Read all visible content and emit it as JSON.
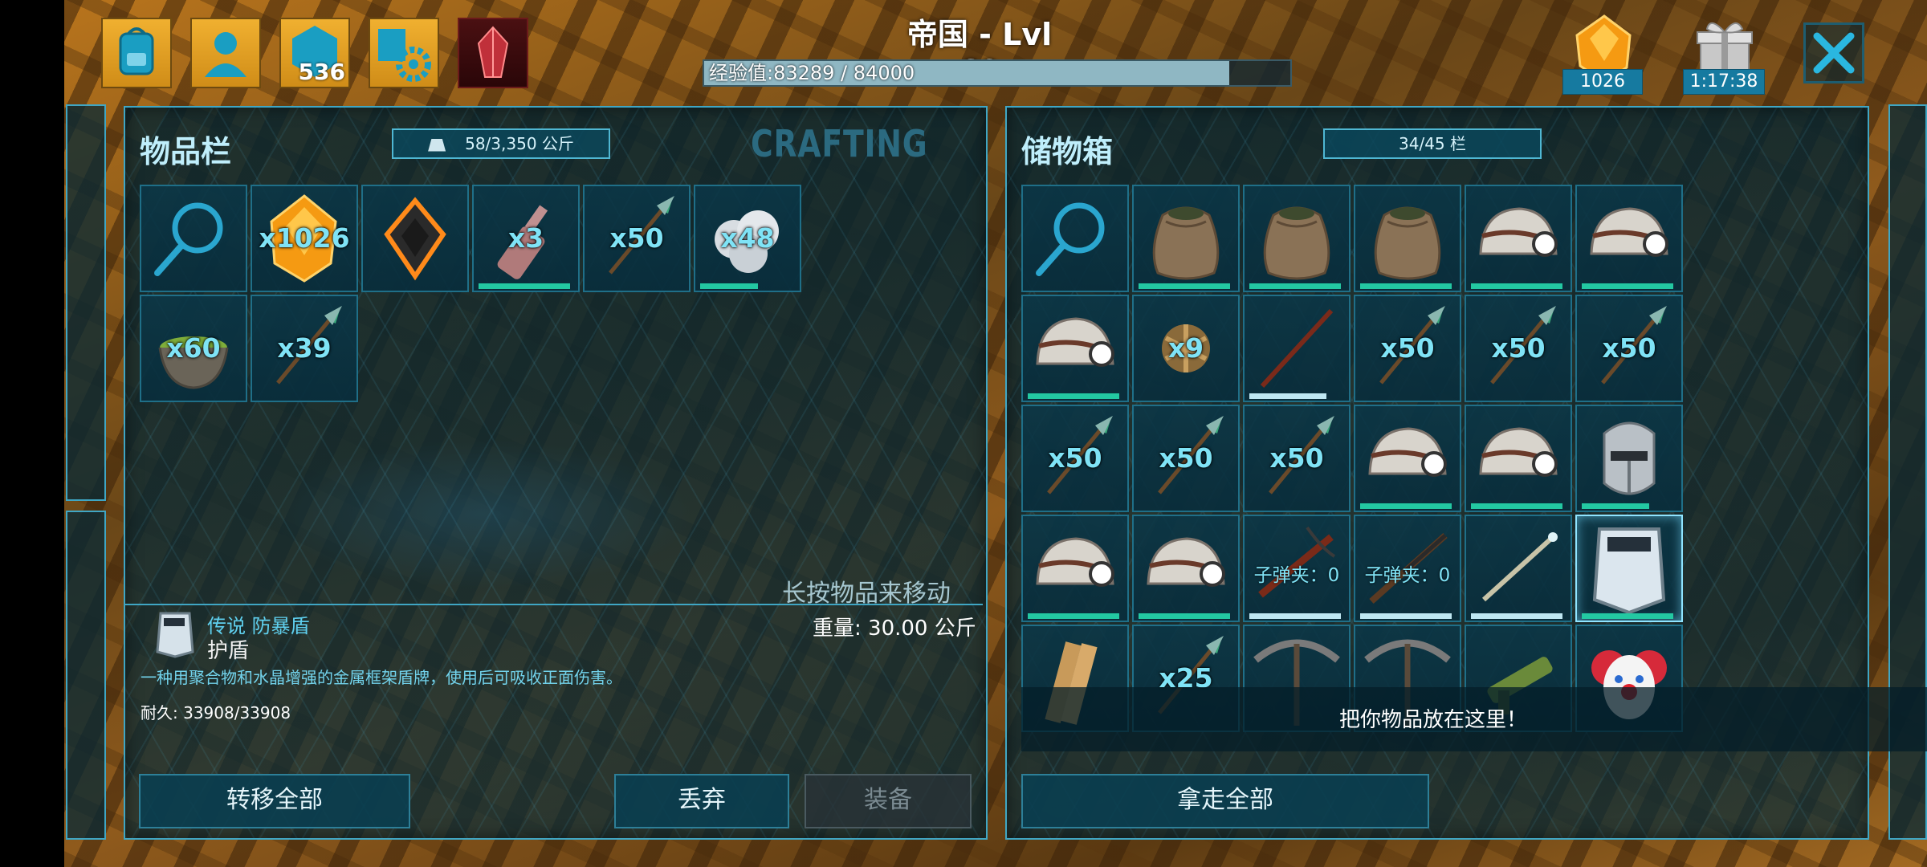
{
  "hud": {
    "title": "帝国 - Lvl 69",
    "xp_text": "经验值:83289 / 84000",
    "xp_fraction": 0.9915,
    "engram_points": "536",
    "resource_count": "1026",
    "timer": "1:17:38",
    "top_icons": [
      "backpack-icon",
      "character-icon",
      "engram-icon",
      "settings-icon",
      "tek-crystal-icon"
    ]
  },
  "inventory": {
    "title": "物品栏",
    "weight_caption": "58/3,350 公斤",
    "crafting_label": "CRAFTING",
    "slots": [
      {
        "icon": "search-icon",
        "qty": ""
      },
      {
        "icon": "element-crystal-icon",
        "qty": "x1026"
      },
      {
        "icon": "implant-icon",
        "qty": ""
      },
      {
        "icon": "bottle-icon",
        "qty": "x3",
        "durability": 0.95
      },
      {
        "icon": "spear-arrow-icon",
        "qty": "x50"
      },
      {
        "icon": "cotton-icon",
        "qty": "x48",
        "durability": 0.6
      },
      {
        "icon": "bowl-soup-icon",
        "qty": "x60"
      },
      {
        "icon": "spear-arrow-icon",
        "qty": "x39"
      }
    ],
    "hint": "长按物品来移动",
    "item_info": {
      "name": "传说 防暴盾",
      "type": "护盾",
      "description": "一种用聚合物和水晶增强的金属框架盾牌，使用后可吸收正面伤害。",
      "durability": "耐久: 33908/33908",
      "weight": "重量: 30.00 公斤"
    },
    "buttons": {
      "transfer_all": "转移全部",
      "drop": "丢弃",
      "equip": "装备"
    }
  },
  "storage": {
    "title": "储物箱",
    "slots_caption": "34/45 栏",
    "drop_hint": "把你物品放在这里！",
    "take_all": "拿走全部",
    "slots": [
      {
        "icon": "search-icon",
        "qty": ""
      },
      {
        "icon": "sack-icon",
        "qty": "",
        "durability": 0.95
      },
      {
        "icon": "sack-icon",
        "qty": "",
        "durability": 0.95
      },
      {
        "icon": "sack-icon",
        "qty": "",
        "durability": 0.95
      },
      {
        "icon": "miner-helmet-icon",
        "qty": "",
        "durability": 0.95
      },
      {
        "icon": "miner-helmet-icon",
        "qty": "",
        "durability": 0.95
      },
      {
        "icon": "miner-helmet-icon",
        "qty": "",
        "durability": 0.95
      },
      {
        "icon": "thatch-ball-icon",
        "qty": "x9"
      },
      {
        "icon": "pike-icon",
        "qty": "",
        "durability": 0.8,
        "light": true
      },
      {
        "icon": "spear-arrow-icon",
        "qty": "x50"
      },
      {
        "icon": "spear-arrow-icon",
        "qty": "x50"
      },
      {
        "icon": "spear-arrow-icon",
        "qty": "x50"
      },
      {
        "icon": "spear-arrow-icon",
        "qty": "x50"
      },
      {
        "icon": "spear-arrow-icon",
        "qty": "x50"
      },
      {
        "icon": "spear-arrow-icon",
        "qty": "x50"
      },
      {
        "icon": "miner-helmet-icon",
        "qty": "",
        "durability": 0.95
      },
      {
        "icon": "miner-helmet-icon",
        "qty": "",
        "durability": 0.95
      },
      {
        "icon": "metal-helmet-icon",
        "qty": "",
        "durability": 0.7
      },
      {
        "icon": "miner-helmet-icon",
        "qty": "",
        "durability": 0.95
      },
      {
        "icon": "miner-helmet-icon",
        "qty": "",
        "durability": 0.95
      },
      {
        "icon": "crossbow-icon",
        "ammo": "子弹夹：0",
        "durability": 0.95,
        "light": true
      },
      {
        "icon": "rifle-icon",
        "ammo": "子弹夹：0",
        "durability": 0.95,
        "light": true
      },
      {
        "icon": "staff-icon",
        "qty": "",
        "durability": 0.95,
        "light": true
      },
      {
        "icon": "riot-shield-icon",
        "qty": "",
        "durability": 0.95,
        "selected": true
      },
      {
        "icon": "wood-plank-icon",
        "qty": ""
      },
      {
        "icon": "spear-arrow-icon",
        "qty": "x25"
      },
      {
        "icon": "pickaxe-icon",
        "qty": ""
      },
      {
        "icon": "pickaxe-icon",
        "qty": ""
      },
      {
        "icon": "launcher-icon",
        "qty": ""
      },
      {
        "icon": "clown-mask-icon",
        "qty": ""
      }
    ]
  },
  "colors": {
    "accent": "#3fa6c4",
    "durability": "#23c8a2",
    "qty_text": "#7fe3f6",
    "hud_icon_bg": "#d08d18"
  }
}
